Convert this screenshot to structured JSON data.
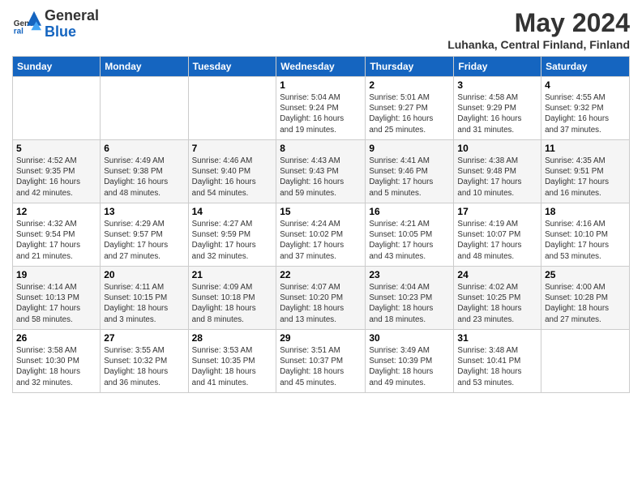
{
  "header": {
    "logo_general": "General",
    "logo_blue": "Blue",
    "month_title": "May 2024",
    "location": "Luhanka, Central Finland, Finland"
  },
  "days_of_week": [
    "Sunday",
    "Monday",
    "Tuesday",
    "Wednesday",
    "Thursday",
    "Friday",
    "Saturday"
  ],
  "weeks": [
    [
      {
        "day": "",
        "info": ""
      },
      {
        "day": "",
        "info": ""
      },
      {
        "day": "",
        "info": ""
      },
      {
        "day": "1",
        "info": "Sunrise: 5:04 AM\nSunset: 9:24 PM\nDaylight: 16 hours\nand 19 minutes."
      },
      {
        "day": "2",
        "info": "Sunrise: 5:01 AM\nSunset: 9:27 PM\nDaylight: 16 hours\nand 25 minutes."
      },
      {
        "day": "3",
        "info": "Sunrise: 4:58 AM\nSunset: 9:29 PM\nDaylight: 16 hours\nand 31 minutes."
      },
      {
        "day": "4",
        "info": "Sunrise: 4:55 AM\nSunset: 9:32 PM\nDaylight: 16 hours\nand 37 minutes."
      }
    ],
    [
      {
        "day": "5",
        "info": "Sunrise: 4:52 AM\nSunset: 9:35 PM\nDaylight: 16 hours\nand 42 minutes."
      },
      {
        "day": "6",
        "info": "Sunrise: 4:49 AM\nSunset: 9:38 PM\nDaylight: 16 hours\nand 48 minutes."
      },
      {
        "day": "7",
        "info": "Sunrise: 4:46 AM\nSunset: 9:40 PM\nDaylight: 16 hours\nand 54 minutes."
      },
      {
        "day": "8",
        "info": "Sunrise: 4:43 AM\nSunset: 9:43 PM\nDaylight: 16 hours\nand 59 minutes."
      },
      {
        "day": "9",
        "info": "Sunrise: 4:41 AM\nSunset: 9:46 PM\nDaylight: 17 hours\nand 5 minutes."
      },
      {
        "day": "10",
        "info": "Sunrise: 4:38 AM\nSunset: 9:48 PM\nDaylight: 17 hours\nand 10 minutes."
      },
      {
        "day": "11",
        "info": "Sunrise: 4:35 AM\nSunset: 9:51 PM\nDaylight: 17 hours\nand 16 minutes."
      }
    ],
    [
      {
        "day": "12",
        "info": "Sunrise: 4:32 AM\nSunset: 9:54 PM\nDaylight: 17 hours\nand 21 minutes."
      },
      {
        "day": "13",
        "info": "Sunrise: 4:29 AM\nSunset: 9:57 PM\nDaylight: 17 hours\nand 27 minutes."
      },
      {
        "day": "14",
        "info": "Sunrise: 4:27 AM\nSunset: 9:59 PM\nDaylight: 17 hours\nand 32 minutes."
      },
      {
        "day": "15",
        "info": "Sunrise: 4:24 AM\nSunset: 10:02 PM\nDaylight: 17 hours\nand 37 minutes."
      },
      {
        "day": "16",
        "info": "Sunrise: 4:21 AM\nSunset: 10:05 PM\nDaylight: 17 hours\nand 43 minutes."
      },
      {
        "day": "17",
        "info": "Sunrise: 4:19 AM\nSunset: 10:07 PM\nDaylight: 17 hours\nand 48 minutes."
      },
      {
        "day": "18",
        "info": "Sunrise: 4:16 AM\nSunset: 10:10 PM\nDaylight: 17 hours\nand 53 minutes."
      }
    ],
    [
      {
        "day": "19",
        "info": "Sunrise: 4:14 AM\nSunset: 10:13 PM\nDaylight: 17 hours\nand 58 minutes."
      },
      {
        "day": "20",
        "info": "Sunrise: 4:11 AM\nSunset: 10:15 PM\nDaylight: 18 hours\nand 3 minutes."
      },
      {
        "day": "21",
        "info": "Sunrise: 4:09 AM\nSunset: 10:18 PM\nDaylight: 18 hours\nand 8 minutes."
      },
      {
        "day": "22",
        "info": "Sunrise: 4:07 AM\nSunset: 10:20 PM\nDaylight: 18 hours\nand 13 minutes."
      },
      {
        "day": "23",
        "info": "Sunrise: 4:04 AM\nSunset: 10:23 PM\nDaylight: 18 hours\nand 18 minutes."
      },
      {
        "day": "24",
        "info": "Sunrise: 4:02 AM\nSunset: 10:25 PM\nDaylight: 18 hours\nand 23 minutes."
      },
      {
        "day": "25",
        "info": "Sunrise: 4:00 AM\nSunset: 10:28 PM\nDaylight: 18 hours\nand 27 minutes."
      }
    ],
    [
      {
        "day": "26",
        "info": "Sunrise: 3:58 AM\nSunset: 10:30 PM\nDaylight: 18 hours\nand 32 minutes."
      },
      {
        "day": "27",
        "info": "Sunrise: 3:55 AM\nSunset: 10:32 PM\nDaylight: 18 hours\nand 36 minutes."
      },
      {
        "day": "28",
        "info": "Sunrise: 3:53 AM\nSunset: 10:35 PM\nDaylight: 18 hours\nand 41 minutes."
      },
      {
        "day": "29",
        "info": "Sunrise: 3:51 AM\nSunset: 10:37 PM\nDaylight: 18 hours\nand 45 minutes."
      },
      {
        "day": "30",
        "info": "Sunrise: 3:49 AM\nSunset: 10:39 PM\nDaylight: 18 hours\nand 49 minutes."
      },
      {
        "day": "31",
        "info": "Sunrise: 3:48 AM\nSunset: 10:41 PM\nDaylight: 18 hours\nand 53 minutes."
      },
      {
        "day": "",
        "info": ""
      }
    ]
  ]
}
